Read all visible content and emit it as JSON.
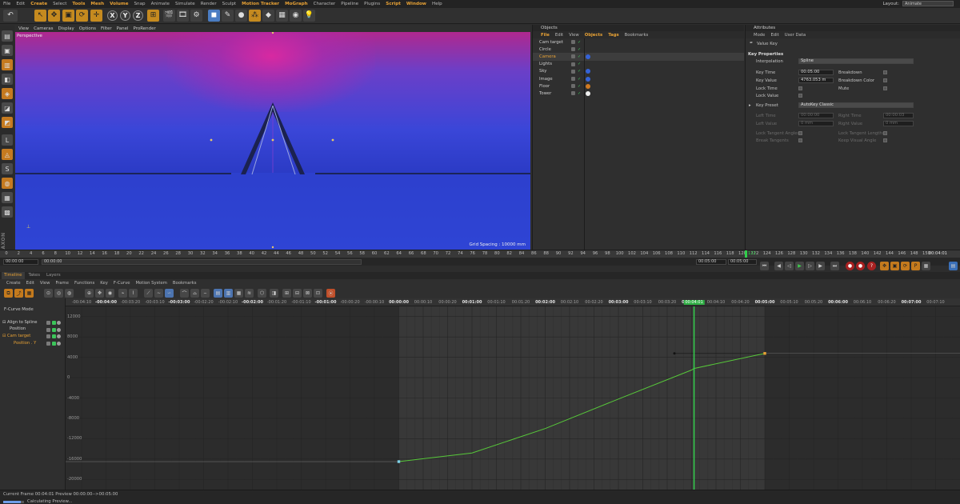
{
  "menubar": {
    "items": [
      "File",
      "Edit",
      "Create",
      "Select",
      "Tools",
      "Mesh",
      "Volume",
      "Snap",
      "Animate",
      "Simulate",
      "Render",
      "Sculpt",
      "Motion Tracker",
      "MoGraph",
      "Character",
      "Pipeline",
      "Plugins",
      "Script",
      "Window",
      "Help"
    ],
    "highlighted": [
      "Create",
      "Tools",
      "Mesh",
      "Volume",
      "Motion Tracker",
      "MoGraph",
      "Script",
      "Window"
    ],
    "layout_label": "Layout:",
    "layout_value": "Animate"
  },
  "toolbar": {
    "icons": [
      "undo-icon",
      "move-select-icon",
      "move-icon",
      "scale-icon",
      "rotate-icon",
      "move-multi-icon",
      "axis-x",
      "axis-y",
      "axis-z",
      "world-coord-icon",
      "render-active-icon",
      "render-view-icon",
      "render-settings-icon",
      "cube-icon",
      "pen-icon",
      "nurbs-icon",
      "array-icon",
      "deformer-icon",
      "scene-icon",
      "camera-icon",
      "light-icon"
    ],
    "axis_labels": [
      "X",
      "Y",
      "Z"
    ]
  },
  "viewport": {
    "menu": [
      "View",
      "Cameras",
      "Display",
      "Options",
      "Filter",
      "Panel",
      "ProRender"
    ],
    "label": "Perspective",
    "grid_spacing": "Grid Spacing : 10000 mm"
  },
  "objects_panel": {
    "title": "Objects",
    "menu": [
      "File",
      "Edit",
      "View",
      "Objects",
      "Tags",
      "Bookmarks"
    ],
    "active_menu": [
      "File",
      "Objects",
      "Tags"
    ],
    "items": [
      {
        "name": "Cam target",
        "active": false
      },
      {
        "name": "Circle",
        "active": false
      },
      {
        "name": "Camera",
        "active": true
      },
      {
        "name": "Lights",
        "active": false
      },
      {
        "name": "Sky",
        "active": false
      },
      {
        "name": "Image",
        "active": false
      },
      {
        "name": "Floor",
        "active": false
      },
      {
        "name": "Tower",
        "active": false
      }
    ]
  },
  "attributes_panel": {
    "title": "Attributes",
    "menu": [
      "Mode",
      "Edit",
      "User Data"
    ],
    "object_label": "Value Key",
    "section": "Key Properties",
    "interpolation_label": "Interpolation",
    "interpolation_value": "Spline",
    "key_time_label": "Key Time",
    "key_time_value": "00:05:00",
    "key_value_label": "Key Value",
    "key_value_value": "4763.053 m",
    "lock_time_label": "Lock Time",
    "lock_value_label": "Lock Value",
    "breakdown_label": "Breakdown",
    "breakdown_color_label": "Breakdown Color",
    "mute_label": "Mute",
    "key_preset_label": "Key Preset",
    "key_preset_value": "AutoKey Classic",
    "left_time_label": "Left Time",
    "left_time_value": "00:00:00",
    "right_time_label": "Right Time",
    "right_time_value": "00:00:03",
    "left_value_label": "Left Value",
    "left_value_value": "0 mm",
    "right_value_label": "Right Value",
    "right_value_value": "0 mm",
    "lock_tangent_angles_label": "Lock Tangent Angles",
    "lock_tangent_lengths_label": "Lock Tangent Lengths",
    "break_tangents_label": "Break Tangents",
    "keep_visual_angle_label": "Keep Visual Angle"
  },
  "timeline_ruler": {
    "ticks": [
      "0",
      "2",
      "4",
      "6",
      "8",
      "10",
      "12",
      "14",
      "16",
      "18",
      "20",
      "22",
      "24",
      "26",
      "28",
      "30",
      "32",
      "34",
      "36",
      "38",
      "40",
      "42",
      "44",
      "46",
      "48",
      "50",
      "52",
      "54",
      "56",
      "58",
      "60",
      "62",
      "64",
      "66",
      "68",
      "70",
      "72",
      "74",
      "76",
      "78",
      "80",
      "82",
      "84",
      "86",
      "88",
      "90",
      "92",
      "94",
      "96",
      "98",
      "100",
      "102",
      "104",
      "106",
      "108",
      "110",
      "112",
      "114",
      "116",
      "118",
      "120",
      "122",
      "124",
      "126",
      "128",
      "130",
      "132",
      "134",
      "136",
      "138",
      "140",
      "142",
      "144",
      "146",
      "148",
      "150"
    ],
    "current_frame_marker": "121",
    "current_time": "00:04:01",
    "start_field": "00:00:00",
    "start_field_2": "00:00:00",
    "end_field": "00:05:00",
    "end_field_2": "00:05:00"
  },
  "timeline": {
    "tabs": [
      "Timeline",
      "Takes",
      "Layers"
    ],
    "active_tab": "Timeline",
    "menu": [
      "Create",
      "Edit",
      "View",
      "Frame",
      "Functions",
      "Key",
      "F-Curve",
      "Motion System",
      "Bookmarks"
    ],
    "mode_label": "F-Curve Mode",
    "tracks": [
      {
        "name": "Align to Spline",
        "highlight": false
      },
      {
        "name": "Position",
        "highlight": false
      },
      {
        "name": "Cam target",
        "highlight": true
      },
      {
        "name": "Position . Y",
        "highlight": true
      }
    ],
    "frame_labels": [
      "-00:04:10",
      "-00:04:00",
      "-00:03:20",
      "-00:03:10",
      "-00:03:00",
      "-00:02:20",
      "-00:02:10",
      "-00:02:00",
      "-00:01:20",
      "-00:01:10",
      "-00:01:00",
      "-00:00:20",
      "-00:00:10",
      "00:00:00",
      "00:00:10",
      "00:00:20",
      "00:01:00",
      "00:01:10",
      "00:01:20",
      "00:02:00",
      "00:02:10",
      "00:02:20",
      "00:03:00",
      "00:03:10",
      "00:03:20",
      "00:04:00",
      "00:04:10",
      "00:04:20",
      "00:05:00",
      "00:05:10",
      "00:05:20",
      "00:06:00",
      "00:06:10",
      "00:06:20",
      "00:07:00",
      "00:07:10"
    ],
    "playhead_label": "00:04:01",
    "y_labels": [
      "12000",
      "8000",
      "4000",
      "0",
      "-4000",
      "-8000",
      "-12000",
      "-16000",
      "-20000"
    ],
    "status_current": "Current Frame  00:04:01  Preview  00:00:00-->00:05:00",
    "status_calc": "Calculating Preview...",
    "calc_progress": 0.85
  },
  "chart_data": {
    "type": "line",
    "series": [
      {
        "name": "Position . Y",
        "x": [
          "00:00:00",
          "00:01:00",
          "00:02:00",
          "00:03:00",
          "00:04:00",
          "00:04:01",
          "00:05:00"
        ],
        "values": [
          -16500,
          -14800,
          -10000,
          -4200,
          1500,
          1800,
          4763.053
        ]
      }
    ],
    "ylim": [
      -22000,
      14000
    ]
  }
}
